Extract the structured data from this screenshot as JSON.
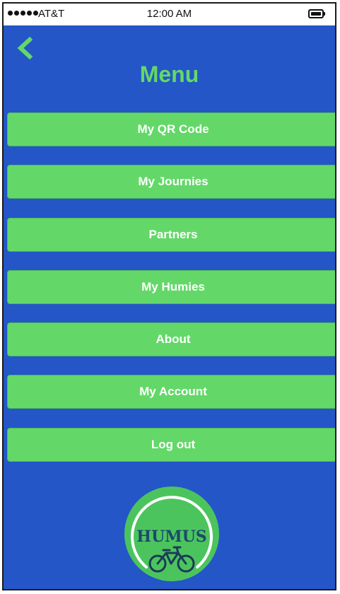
{
  "status_bar": {
    "carrier": "AT&T",
    "time": "12:00 AM",
    "signal_dots": 5,
    "battery_icon": "battery-full-icon"
  },
  "header": {
    "back_icon": "chevron-left-icon",
    "title": "Menu"
  },
  "menu": {
    "items": [
      {
        "label": "My QR Code"
      },
      {
        "label": "My Journies"
      },
      {
        "label": "Partners"
      },
      {
        "label": "My Humies"
      },
      {
        "label": "About"
      },
      {
        "label": "My Account"
      },
      {
        "label": "Log out"
      }
    ]
  },
  "logo": {
    "text": "HUMUS",
    "icon": "bicycle-icon"
  },
  "colors": {
    "background": "#2456c7",
    "accent_green": "#63d868",
    "logo_circle": "#4cc45e",
    "logo_text": "#1b4a6b",
    "button_text": "#ffffff",
    "status_bar": "#ffffff"
  }
}
